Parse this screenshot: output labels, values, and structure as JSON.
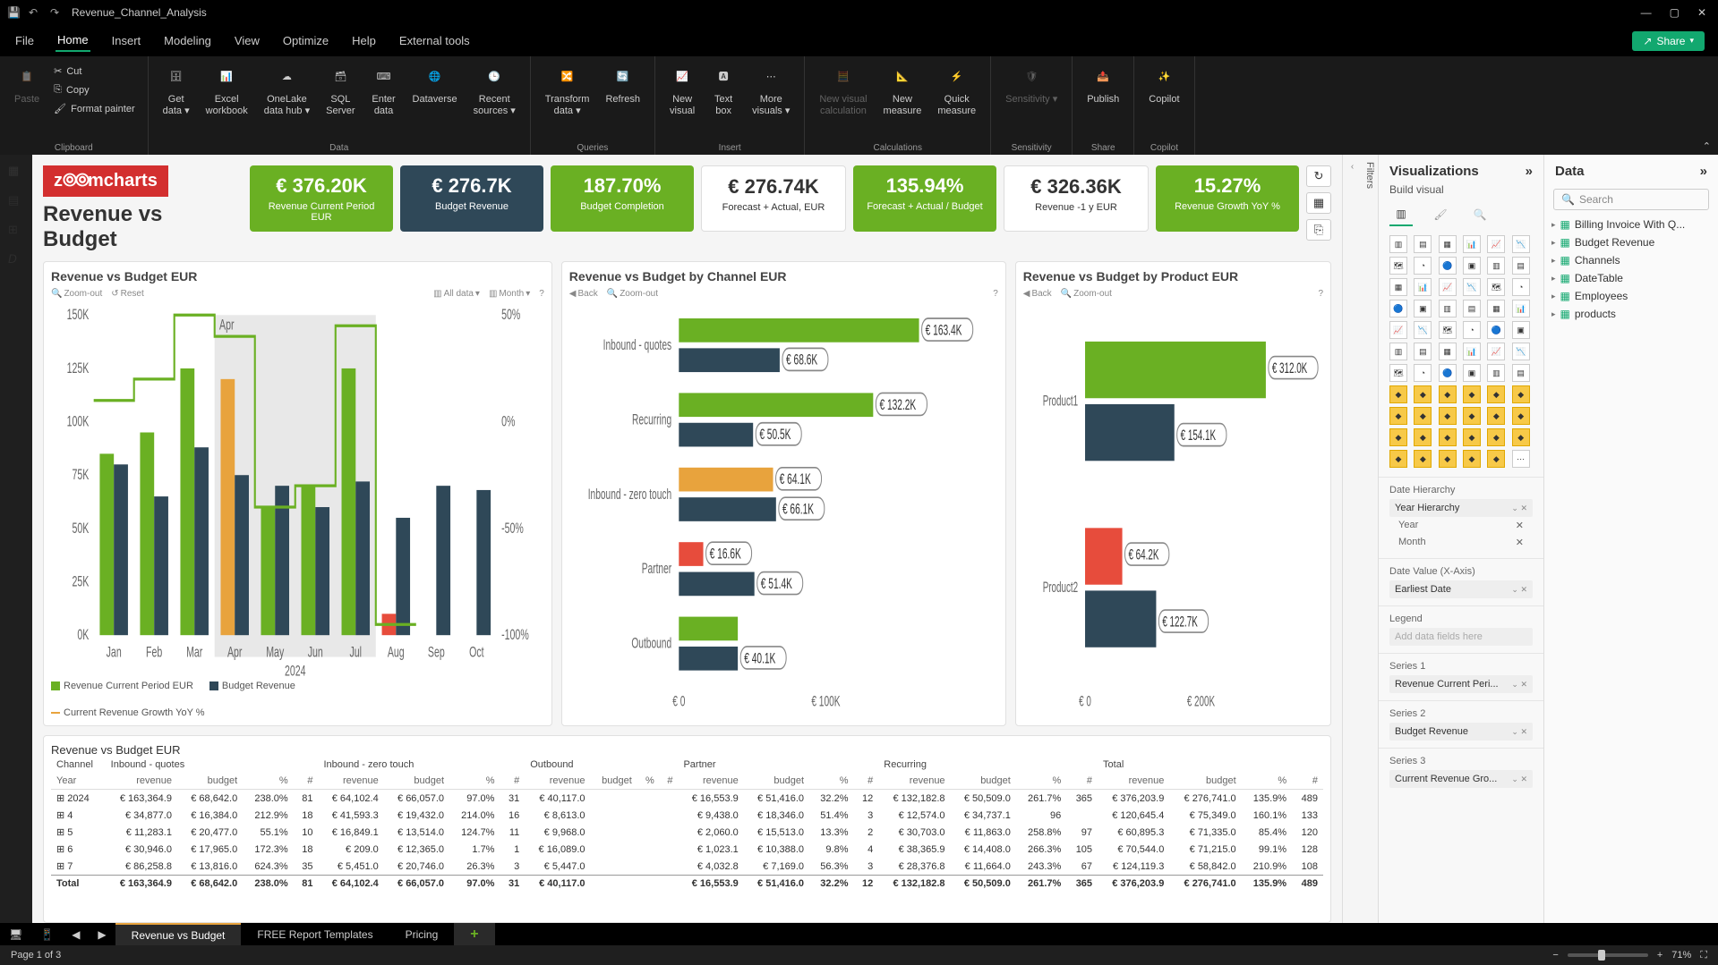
{
  "titlebar": {
    "doc": "Revenue_Channel_Analysis"
  },
  "menu": {
    "items": [
      "File",
      "Home",
      "Insert",
      "Modeling",
      "View",
      "Optimize",
      "Help",
      "External tools"
    ],
    "share": "Share"
  },
  "ribbon": {
    "clipboard": {
      "paste": "Paste",
      "cut": "Cut",
      "copy": "Copy",
      "fmt": "Format painter",
      "label": "Clipboard"
    },
    "data": {
      "items": [
        "Get\ndata",
        "Excel\nworkbook",
        "OneLake\ndata hub",
        "SQL\nServer",
        "Enter\ndata",
        "Dataverse",
        "Recent\nsources"
      ],
      "label": "Data"
    },
    "queries": {
      "items": [
        "Transform\ndata",
        "Refresh"
      ],
      "label": "Queries"
    },
    "insert": {
      "items": [
        "New\nvisual",
        "Text\nbox",
        "More\nvisuals"
      ],
      "label": "Insert"
    },
    "calc": {
      "items": [
        "New visual\ncalculation",
        "New\nmeasure",
        "Quick\nmeasure"
      ],
      "label": "Calculations"
    },
    "sens": {
      "items": [
        "Sensitivity"
      ],
      "label": "Sensitivity"
    },
    "share": {
      "items": [
        "Publish"
      ],
      "label": "Share"
    },
    "copilot": {
      "items": [
        "Copilot"
      ],
      "label": "Copilot"
    }
  },
  "report": {
    "logo": "zoomcharts",
    "title": "Revenue vs Budget",
    "kpis": [
      {
        "value": "€ 376.20K",
        "label": "Revenue Current Period EUR",
        "cls": "green"
      },
      {
        "value": "€ 276.7K",
        "label": "Budget Revenue",
        "cls": "blue"
      },
      {
        "value": "187.70%",
        "label": "Budget Completion",
        "cls": "green"
      },
      {
        "value": "€ 276.74K",
        "label": "Forecast + Actual, EUR",
        "cls": "white"
      },
      {
        "value": "135.94%",
        "label": "Forecast + Actual / Budget",
        "cls": "green"
      },
      {
        "value": "€ 326.36K",
        "label": "Revenue -1 y EUR",
        "cls": "white"
      },
      {
        "value": "15.27%",
        "label": "Revenue Growth YoY %",
        "cls": "green"
      }
    ],
    "chart1": {
      "title": "Revenue vs Budget EUR",
      "toolbar_left": [
        "Zoom-out",
        "Reset"
      ],
      "toolbar_right": [
        "All data",
        "Month"
      ],
      "highlight": {
        "month": "Apr",
        "sub": "Jul"
      },
      "year": "2024",
      "legend": [
        "Revenue Current Period EUR",
        "Budget Revenue",
        "Current Revenue Growth YoY %"
      ]
    },
    "chart2": {
      "title": "Revenue vs Budget by Channel EUR",
      "back": "Back",
      "zoom": "Zoom-out"
    },
    "chart3": {
      "title": "Revenue vs Budget by Product EUR",
      "back": "Back",
      "zoom": "Zoom-out"
    },
    "table": {
      "title": "Revenue vs Budget EUR",
      "channel_head": "Channel",
      "year_head": "Year",
      "groups": [
        "Inbound - quotes",
        "Inbound - zero touch",
        "Outbound",
        "Partner",
        "Recurring",
        "Total"
      ],
      "cols": [
        "revenue",
        "budget",
        "%",
        "#"
      ],
      "rows": [
        {
          "y": "2024",
          "c": [
            "€ 163,364.9",
            "€ 68,642.0",
            "238.0%",
            "81",
            "€ 64,102.4",
            "€ 66,057.0",
            "97.0%",
            "31",
            "€ 40,117.0",
            "",
            "",
            "",
            "€ 16,553.9",
            "€ 51,416.0",
            "32.2%",
            "12",
            "€ 132,182.8",
            "€ 50,509.0",
            "261.7%",
            "365",
            "€ 376,203.9",
            "€ 276,741.0",
            "135.9%",
            "489"
          ]
        },
        {
          "y": "4",
          "c": [
            "€ 34,877.0",
            "€ 16,384.0",
            "212.9%",
            "18",
            "€ 41,593.3",
            "€ 19,432.0",
            "214.0%",
            "16",
            "€ 8,613.0",
            "",
            "",
            "",
            "€ 9,438.0",
            "€ 18,346.0",
            "51.4%",
            "3",
            "€ 12,574.0",
            "€ 34,737.1",
            "96",
            "",
            "€ 120,645.4",
            "€ 75,349.0",
            "160.1%",
            "133"
          ]
        },
        {
          "y": "5",
          "c": [
            "€ 11,283.1",
            "€ 20,477.0",
            "55.1%",
            "10",
            "€ 16,849.1",
            "€ 13,514.0",
            "124.7%",
            "11",
            "€ 9,968.0",
            "",
            "",
            "",
            "€ 2,060.0",
            "€ 15,513.0",
            "13.3%",
            "2",
            "€ 30,703.0",
            "€ 11,863.0",
            "258.8%",
            "97",
            "€ 60,895.3",
            "€ 71,335.0",
            "85.4%",
            "120"
          ]
        },
        {
          "y": "6",
          "c": [
            "€ 30,946.0",
            "€ 17,965.0",
            "172.3%",
            "18",
            "€ 209.0",
            "€ 12,365.0",
            "1.7%",
            "1",
            "€ 16,089.0",
            "",
            "",
            "",
            "€ 1,023.1",
            "€ 10,388.0",
            "9.8%",
            "4",
            "€ 38,365.9",
            "€ 14,408.0",
            "266.3%",
            "105",
            "€ 70,544.0",
            "€ 71,215.0",
            "99.1%",
            "128"
          ]
        },
        {
          "y": "7",
          "c": [
            "€ 86,258.8",
            "€ 13,816.0",
            "624.3%",
            "35",
            "€ 5,451.0",
            "€ 20,746.0",
            "26.3%",
            "3",
            "€ 5,447.0",
            "",
            "",
            "",
            "€ 4,032.8",
            "€ 7,169.0",
            "56.3%",
            "3",
            "€ 28,376.8",
            "€ 11,664.0",
            "243.3%",
            "67",
            "€ 124,119.3",
            "€ 58,842.0",
            "210.9%",
            "108"
          ]
        }
      ],
      "total": {
        "y": "Total",
        "c": [
          "€ 163,364.9",
          "€ 68,642.0",
          "238.0%",
          "81",
          "€ 64,102.4",
          "€ 66,057.0",
          "97.0%",
          "31",
          "€ 40,117.0",
          "",
          "",
          "",
          "€ 16,553.9",
          "€ 51,416.0",
          "32.2%",
          "12",
          "€ 132,182.8",
          "€ 50,509.0",
          "261.7%",
          "365",
          "€ 376,203.9",
          "€ 276,741.0",
          "135.9%",
          "489"
        ]
      }
    }
  },
  "viz": {
    "title": "Visualizations",
    "sub": "Build visual",
    "sections": {
      "date_hier": "Date Hierarchy",
      "year_hier": "Year Hierarchy",
      "year": "Year",
      "month": "Month",
      "date_val": "Date Value (X-Axis)",
      "earliest": "Earliest Date",
      "legend": "Legend",
      "legend_ph": "Add data fields here",
      "s1": "Series 1",
      "s1v": "Revenue Current Peri...",
      "s2": "Series 2",
      "s2v": "Budget Revenue",
      "s3": "Series 3",
      "s3v": "Current Revenue Gro..."
    }
  },
  "data": {
    "title": "Data",
    "search": "Search",
    "tables": [
      "Billing Invoice With Q...",
      "Budget Revenue",
      "Channels",
      "DateTable",
      "Employees",
      "products"
    ]
  },
  "tabs": {
    "items": [
      "Revenue vs Budget",
      "FREE Report Templates",
      "Pricing"
    ]
  },
  "status": {
    "page": "Page 1 of 3",
    "zoom": "71%"
  },
  "filters": {
    "label": "Filters"
  },
  "chart_data": [
    {
      "type": "bar",
      "title": "Revenue vs Budget EUR",
      "categories": [
        "Jan",
        "Feb",
        "Mar",
        "Apr",
        "May",
        "Jun",
        "Jul",
        "Aug",
        "Sep",
        "Oct"
      ],
      "series": [
        {
          "name": "Revenue Current Period EUR",
          "values": [
            85,
            95,
            125,
            120,
            60,
            70,
            125,
            10,
            null,
            null
          ],
          "color": "#6ab023"
        },
        {
          "name": "Budget Revenue",
          "values": [
            80,
            65,
            88,
            75,
            70,
            60,
            72,
            55,
            70,
            68
          ],
          "color": "#2f4858"
        },
        {
          "name": "Current Revenue Growth YoY %",
          "values": [
            10,
            20,
            50,
            40,
            -40,
            -30,
            45,
            -95,
            null,
            null
          ],
          "color": "#e8a33d",
          "axis": "right"
        }
      ],
      "ylim": [
        0,
        150
      ],
      "ylabel": "K",
      "ylim2": [
        -100,
        50
      ],
      "year": "2024",
      "highlight": "Apr"
    },
    {
      "type": "bar",
      "orientation": "h",
      "title": "Revenue vs Budget by Channel EUR",
      "categories": [
        "Inbound - quotes",
        "Recurring",
        "Inbound - zero touch",
        "Partner",
        "Outbound"
      ],
      "series": [
        {
          "name": "Revenue",
          "values": [
            163.4,
            132.2,
            64.1,
            16.6,
            40.1
          ],
          "color": "#6ab023",
          "labels": [
            "€ 163.4K",
            "€ 132.2K",
            "€ 64.1K",
            "€ 16.6K",
            ""
          ]
        },
        {
          "name": "Budget",
          "values": [
            68.6,
            50.5,
            66.1,
            51.4,
            40.1
          ],
          "color": "#2f4858",
          "labels": [
            "€ 68.6K",
            "€ 50.5K",
            "€ 66.1K",
            "€ 51.4K",
            "€ 40.1K"
          ]
        }
      ],
      "xlim": [
        0,
        180
      ],
      "xticks": [
        "€ 0",
        "€ 100K"
      ]
    },
    {
      "type": "bar",
      "orientation": "h",
      "title": "Revenue vs Budget by Product EUR",
      "categories": [
        "Product1",
        "Product2"
      ],
      "series": [
        {
          "name": "Revenue",
          "values": [
            312.0,
            64.2
          ],
          "color": "#6ab023",
          "labels": [
            "€ 312.0K",
            "€ 64.2K"
          ]
        },
        {
          "name": "Budget",
          "values": [
            154.1,
            122.7
          ],
          "color": "#2f4858",
          "labels": [
            "€ 154.1K",
            "€ 122.7K"
          ]
        }
      ],
      "xlim": [
        0,
        320
      ],
      "xticks": [
        "€ 0",
        "€ 200K"
      ]
    }
  ]
}
